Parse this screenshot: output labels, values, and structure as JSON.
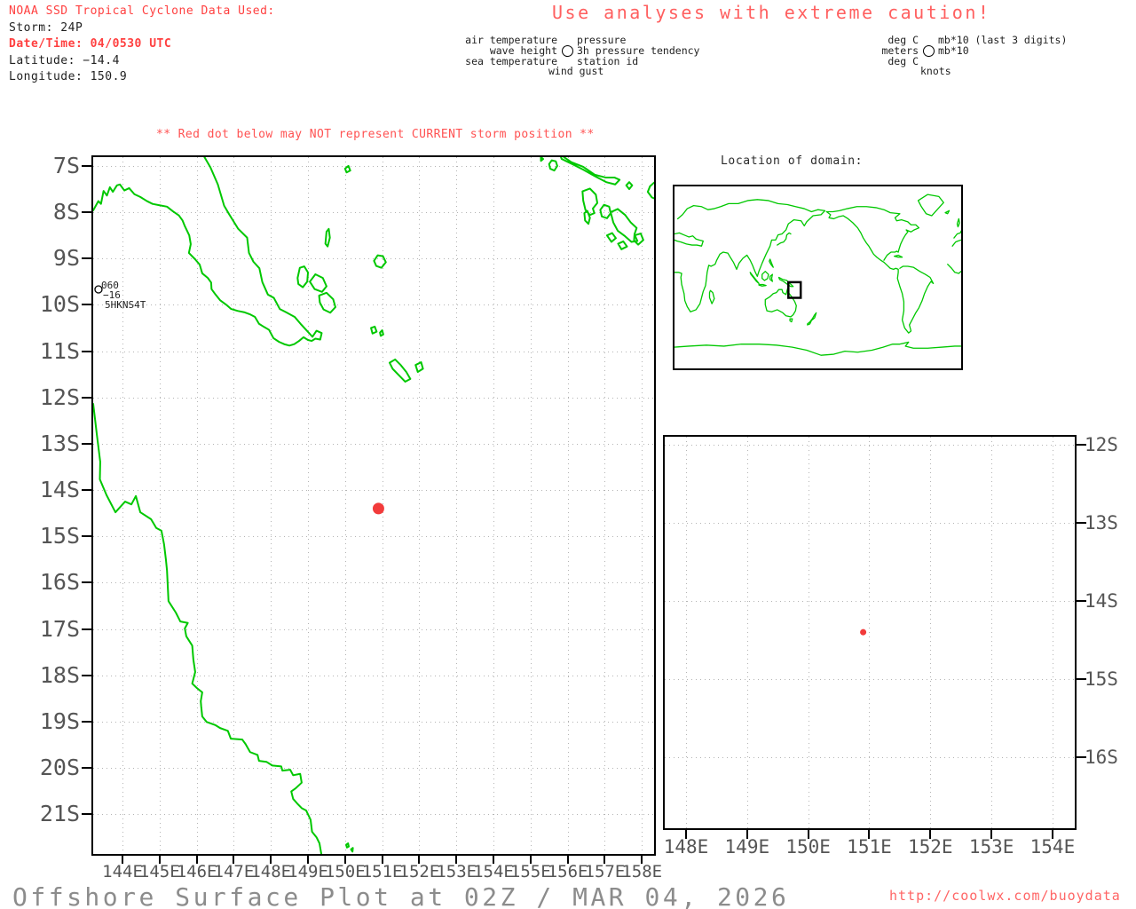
{
  "header": {
    "noaa_line": "NOAA SSD Tropical Cyclone Data Used:",
    "storm_line": "Storm: 24P",
    "datetime_line": "Date/Time: 04/0530 UTC",
    "latitude_line": "Latitude: −14.4",
    "longitude_line": "Longitude: 150.9",
    "caution_title": "Use analyses with extreme caution!"
  },
  "station_legend": {
    "rows": [
      {
        "left": "air temperature",
        "right": "pressure"
      },
      {
        "left": "wave height",
        "right": "3h pressure tendency"
      },
      {
        "left": "sea temperature",
        "right": "station id"
      }
    ],
    "bottom": "wind gust"
  },
  "units_legend": {
    "rows": [
      {
        "left": "deg C",
        "right": "mb*10 (last 3 digits)"
      },
      {
        "left": "meters",
        "right": "mb*10"
      },
      {
        "left": "deg C",
        "right": ""
      }
    ],
    "bottom": "knots"
  },
  "warning_line": "** Red dot below may NOT represent CURRENT storm position **",
  "storm": {
    "id": "24P",
    "lon": 150.9,
    "lat": -14.4
  },
  "main_map": {
    "lat_labels": [
      "7S",
      "8S",
      "9S",
      "10S",
      "11S",
      "12S",
      "13S",
      "14S",
      "15S",
      "16S",
      "17S",
      "18S",
      "19S",
      "20S",
      "21S"
    ],
    "lon_labels": [
      "144E",
      "145E",
      "146E",
      "147E",
      "148E",
      "149E",
      "150E",
      "151E",
      "152E",
      "153E",
      "154E",
      "155E",
      "156E",
      "157E",
      "158E"
    ],
    "station": {
      "pressure": "060",
      "tendency": "−16",
      "station_id": "5HKNS4T"
    }
  },
  "domain_inset": {
    "title": "Location of domain:"
  },
  "zoom_map": {
    "lat_labels": [
      "12S",
      "13S",
      "14S",
      "15S",
      "16S"
    ],
    "lon_labels": [
      "148E",
      "149E",
      "150E",
      "151E",
      "152E",
      "153E",
      "154E"
    ]
  },
  "footer": {
    "title": "Offshore Surface Plot at 02Z / MAR 04, 2026",
    "url": "http://coolwx.com/buoydata"
  },
  "colors": {
    "coastline": "#00c800",
    "storm_dot": "#f23b3b",
    "header_red": "#ff4040",
    "axis_gray": "#555555"
  }
}
